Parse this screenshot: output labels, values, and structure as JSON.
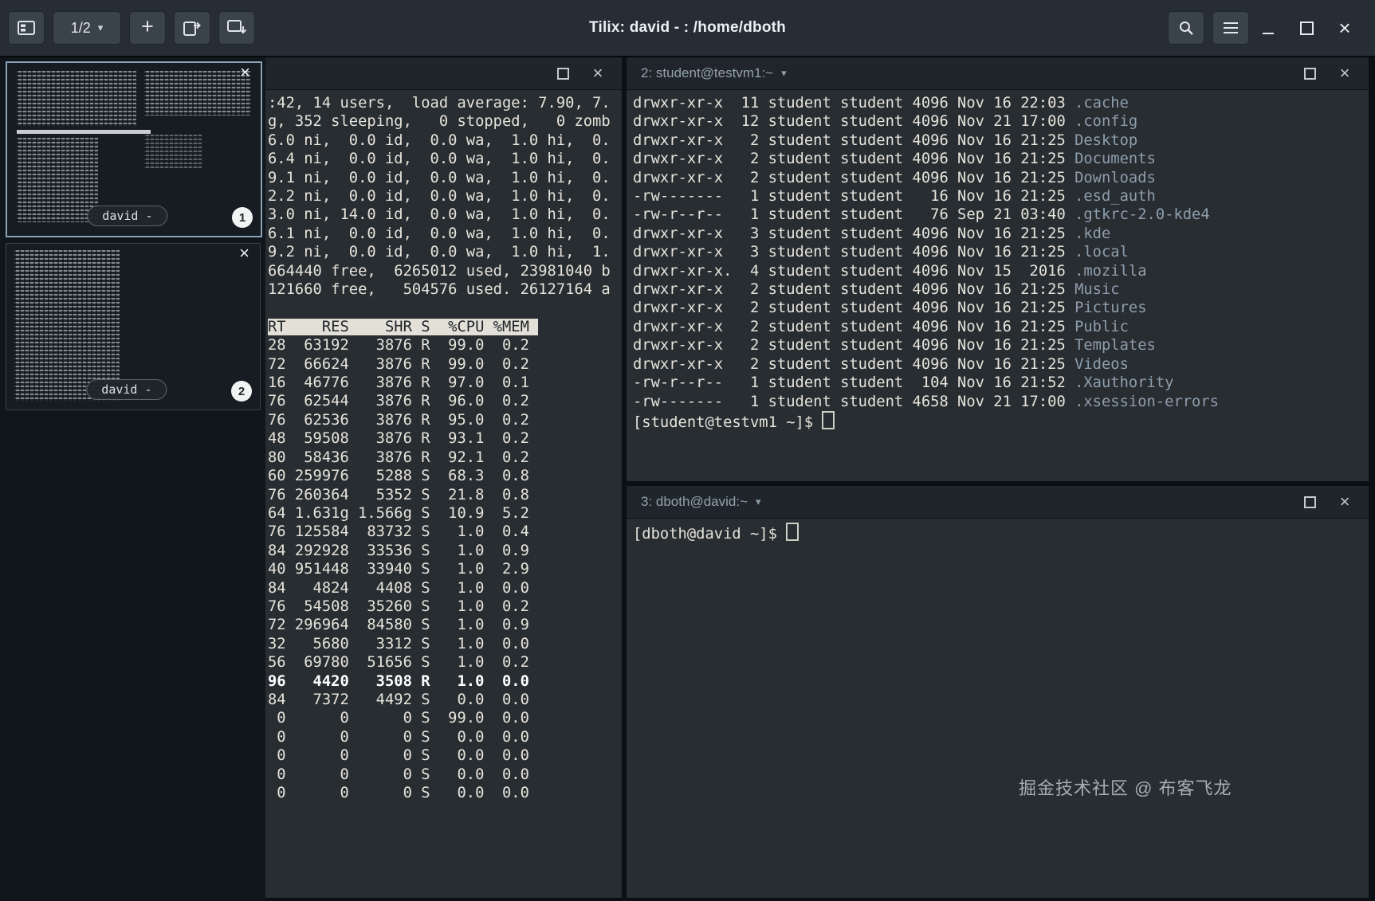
{
  "header": {
    "title": "Tilix: david - : /home/dboth",
    "session_pager_label": "1/2",
    "add_session_label": "+"
  },
  "glyphs": {
    "caret_down": "▾",
    "close": "×"
  },
  "colors": {
    "terminal_background": "#282d32",
    "terminal_foreground": "#e6e3da",
    "file_name_color": "#8e9eac",
    "selected_thumbnail_border": "#8aa2b8",
    "inverse_header_background": "#e3e0d7"
  },
  "sidebar": {
    "sessions": [
      {
        "label": "david -",
        "badge": "1"
      },
      {
        "label": "david -",
        "badge": "2"
      }
    ]
  },
  "pane_top": {
    "summary_lines": [
      ":42, 14 users,  load average: 7.90, 7.",
      "g, 352 sleeping,   0 stopped,   0 zomb",
      "6.0 ni,  0.0 id,  0.0 wa,  1.0 hi,  0.",
      "6.4 ni,  0.0 id,  0.0 wa,  1.0 hi,  0.",
      "9.1 ni,  0.0 id,  0.0 wa,  1.0 hi,  0.",
      "2.2 ni,  0.0 id,  0.0 wa,  1.0 hi,  0.",
      "3.0 ni, 14.0 id,  0.0 wa,  1.0 hi,  0.",
      "6.1 ni,  0.0 id,  0.0 wa,  1.0 hi,  0.",
      "9.2 ni,  0.0 id,  0.0 wa,  1.0 hi,  1.",
      "664440 free,  6265012 used, 23981040 b",
      "121660 free,   504576 used. 26127164 a",
      ""
    ],
    "table_header": "RT    RES    SHR S  %CPU %MEM ",
    "rows": [
      {
        "text": "28  63192   3876 R  99.0  0.2"
      },
      {
        "text": "72  66624   3876 R  99.0  0.2"
      },
      {
        "text": "16  46776   3876 R  97.0  0.1"
      },
      {
        "text": "76  62544   3876 R  96.0  0.2"
      },
      {
        "text": "76  62536   3876 R  95.0  0.2"
      },
      {
        "text": "48  59508   3876 R  93.1  0.2"
      },
      {
        "text": "80  58436   3876 R  92.1  0.2"
      },
      {
        "text": "60 259976   5288 S  68.3  0.8"
      },
      {
        "text": "76 260364   5352 S  21.8  0.8"
      },
      {
        "text": "64 1.631g 1.566g S  10.9  5.2"
      },
      {
        "text": "76 125584  83732 S   1.0  0.4"
      },
      {
        "text": "84 292928  33536 S   1.0  0.9"
      },
      {
        "text": "40 951448  33940 S   1.0  2.9"
      },
      {
        "text": "84   4824   4408 S   1.0  0.0"
      },
      {
        "text": "76  54508  35260 S   1.0  0.2"
      },
      {
        "text": "72 296964  84580 S   1.0  0.9"
      },
      {
        "text": "32   5680   3312 S   1.0  0.0"
      },
      {
        "text": "56  69780  51656 S   1.0  0.2"
      },
      {
        "text": "96   4420   3508 R   1.0  0.0",
        "style": "boldrow"
      },
      {
        "text": "84   7372   4492 S   0.0  0.0"
      },
      {
        "text": " 0      0      0 S  99.0  0.0"
      },
      {
        "text": " 0      0      0 S   0.0  0.0"
      },
      {
        "text": " 0      0      0 S   0.0  0.0"
      },
      {
        "text": " 0      0      0 S   0.0  0.0"
      },
      {
        "text": " 0      0      0 S   0.0  0.0"
      }
    ]
  },
  "pane_student": {
    "title": "2: student@testvm1:~",
    "entries": [
      {
        "meta": "drwxr-xr-x  11 student student 4096 Nov 16 22:03 ",
        "name": ".cache"
      },
      {
        "meta": "drwxr-xr-x  12 student student 4096 Nov 21 17:00 ",
        "name": ".config"
      },
      {
        "meta": "drwxr-xr-x   2 student student 4096 Nov 16 21:25 ",
        "name": "Desktop"
      },
      {
        "meta": "drwxr-xr-x   2 student student 4096 Nov 16 21:25 ",
        "name": "Documents"
      },
      {
        "meta": "drwxr-xr-x   2 student student 4096 Nov 16 21:25 ",
        "name": "Downloads"
      },
      {
        "meta": "-rw-------   1 student student   16 Nov 16 21:25 ",
        "name": ".esd_auth"
      },
      {
        "meta": "-rw-r--r--   1 student student   76 Sep 21 03:40 ",
        "name": ".gtkrc-2.0-kde4"
      },
      {
        "meta": "drwxr-xr-x   3 student student 4096 Nov 16 21:25 ",
        "name": ".kde"
      },
      {
        "meta": "drwxr-xr-x   3 student student 4096 Nov 16 21:25 ",
        "name": ".local"
      },
      {
        "meta": "drwxr-xr-x.  4 student student 4096 Nov 15  2016 ",
        "name": ".mozilla"
      },
      {
        "meta": "drwxr-xr-x   2 student student 4096 Nov 16 21:25 ",
        "name": "Music"
      },
      {
        "meta": "drwxr-xr-x   2 student student 4096 Nov 16 21:25 ",
        "name": "Pictures"
      },
      {
        "meta": "drwxr-xr-x   2 student student 4096 Nov 16 21:25 ",
        "name": "Public"
      },
      {
        "meta": "drwxr-xr-x   2 student student 4096 Nov 16 21:25 ",
        "name": "Templates"
      },
      {
        "meta": "drwxr-xr-x   2 student student 4096 Nov 16 21:25 ",
        "name": "Videos"
      },
      {
        "meta": "-rw-r--r--   1 student student  104 Nov 16 21:52 ",
        "name": ".Xauthority"
      },
      {
        "meta": "-rw-------   1 student student 4658 Nov 21 17:00 ",
        "name": ".xsession-errors"
      }
    ],
    "prompt": "[student@testvm1 ~]$ "
  },
  "pane_dboth": {
    "title": "3: dboth@david:~",
    "prompt": "[dboth@david ~]$ "
  },
  "watermark": "掘金技术社区 @ 布客飞龙"
}
